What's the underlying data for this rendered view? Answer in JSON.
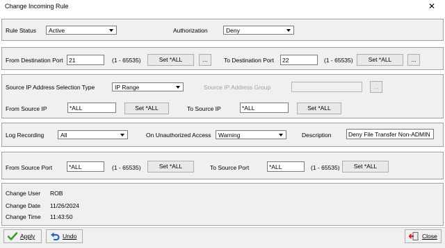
{
  "window": {
    "title": "Change Incoming Rule"
  },
  "rule": {
    "status_label": "Rule Status",
    "status_value": "Active",
    "authorization_label": "Authorization",
    "authorization_value": "Deny"
  },
  "dest_port": {
    "from_label": "From Destination Port",
    "from_value": "21",
    "range_hint": "(1 - 65535)",
    "set_all": "Set *ALL",
    "browse": "...",
    "to_label": "To Destination Port",
    "to_value": "22"
  },
  "source_ip": {
    "selection_type_label": "Source IP Address Selection Type",
    "selection_type_value": "IP Range",
    "group_label": "Source IP Address Group",
    "group_value": "",
    "browse": "...",
    "from_label": "From Source IP",
    "from_value": "*ALL",
    "to_label": "To Source IP",
    "to_value": "*ALL",
    "set_all": "Set *ALL"
  },
  "logging": {
    "log_label": "Log Recording",
    "log_value": "All",
    "unauth_label": "On Unauthorized Access",
    "unauth_value": "Warning",
    "description_label": "Description",
    "description_value": "Deny File Transfer Non-ADMIN"
  },
  "source_port": {
    "from_label": "From Source Port",
    "from_value": "*ALL",
    "range_hint": "(1 - 65535)",
    "set_all": "Set *ALL",
    "to_label": "To Source Port",
    "to_value": "*ALL"
  },
  "audit": {
    "user_label": "Change User",
    "user_value": "ROB",
    "date_label": "Change Date",
    "date_value": "11/26/2024",
    "time_label": "Change Time",
    "time_value": "11:43:50"
  },
  "buttons": {
    "apply": "Apply",
    "undo": "Undo",
    "close": "Close"
  },
  "icons": {
    "close_window": "close-icon",
    "apply": "checkmark-icon",
    "undo": "undo-arrow-icon",
    "close": "exit-door-icon"
  },
  "colors": {
    "dialog_bg": "#f0f0f0",
    "apply_green": "#3a9a2a",
    "undo_blue": "#2b62b8",
    "close_red": "#cc2222"
  }
}
